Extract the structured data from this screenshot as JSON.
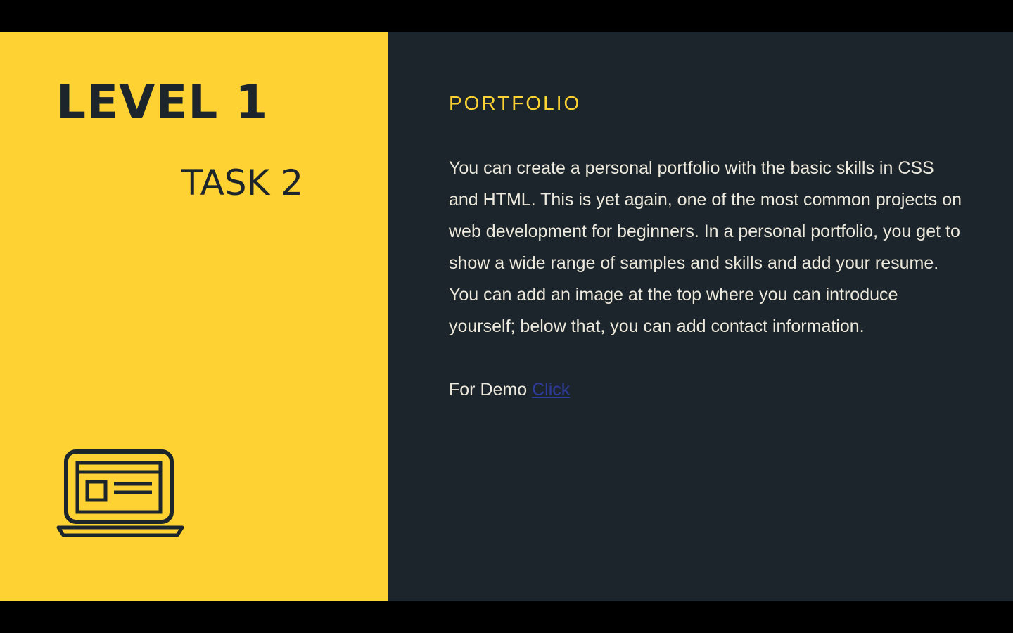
{
  "left": {
    "level_title": "LEVEL 1",
    "task_title": "TASK 2",
    "icon": "laptop-icon"
  },
  "right": {
    "heading": "PORTFOLIO",
    "body": "You can create a personal portfolio with the basic skills in CSS and HTML. This is yet again, one of the most common projects on web development for beginners. In a personal portfolio, you get to show a wide range of samples and skills and add your resume. You can add an image at the top where you can introduce yourself; below that, you can add contact information.",
    "demo_prefix": "For Demo ",
    "demo_link": "Click"
  },
  "colors": {
    "accent_yellow": "#FFD234",
    "dark_panel": "#1C252B",
    "body_text": "#EDE9DC",
    "link": "#2F3C9E"
  }
}
